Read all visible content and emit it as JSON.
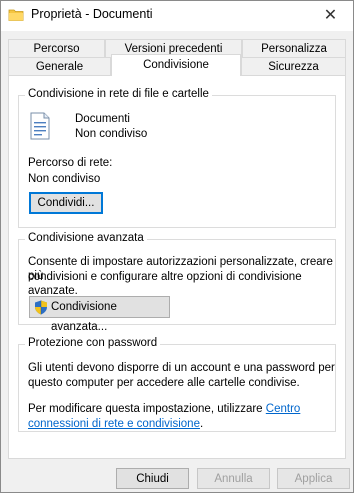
{
  "window": {
    "title": "Proprietà - Documenti",
    "close_glyph": "✕"
  },
  "tabs": {
    "row1": [
      "Percorso",
      "Versioni precedenti",
      "Personalizza"
    ],
    "row2": [
      "Generale",
      "Condivisione",
      "Sicurezza"
    ],
    "active": "Condivisione"
  },
  "network_sharing": {
    "group_title": "Condivisione in rete di file e cartelle",
    "folder_name": "Documenti",
    "folder_status": "Non condiviso",
    "path_label": "Percorso di rete:",
    "path_value": "Non condiviso",
    "share_button": "Condividi..."
  },
  "advanced_sharing": {
    "group_title": "Condivisione avanzata",
    "description_line1": "Consente di impostare autorizzazioni personalizzate, creare più",
    "description_line2": "condivisioni e configurare altre opzioni di condivisione avanzate.",
    "button": "Condivisione avanzata..."
  },
  "password_protection": {
    "group_title": "Protezione con password",
    "line1": "Gli utenti devono disporre di un account e una password per",
    "line2": "questo computer per accedere alle cartelle condivise.",
    "line3_prefix": "Per modificare questa impostazione, utilizzare",
    "link_part1": "Centro",
    "link_part2": "connessioni di rete e condivisione",
    "line4_suffix": "."
  },
  "footer": {
    "close_button": "Chiudi",
    "cancel_button": "Annulla",
    "apply_button": "Applica"
  },
  "colors": {
    "accent": "#0078d7",
    "link": "#0066cc",
    "disabled_text": "#a0a0a0"
  }
}
